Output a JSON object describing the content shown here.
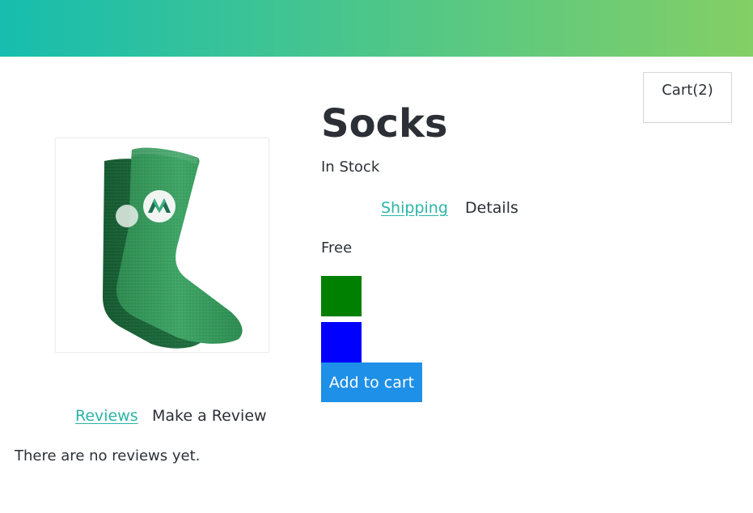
{
  "header": {
    "gradient_start": "#17bdae",
    "gradient_end": "#84cf66"
  },
  "cart": {
    "label": "Cart(2)"
  },
  "product": {
    "title": "Socks",
    "stock_status": "In Stock",
    "image": {
      "description": "green-sock-pair-with-logo",
      "icon": "sock-image"
    }
  },
  "info_tabs": {
    "shipping_label": "Shipping",
    "details_label": "Details",
    "active": "Details",
    "shipping_value": "Free"
  },
  "variants": [
    {
      "name": "green",
      "color": "#008000"
    },
    {
      "name": "blue",
      "color": "#0000ff"
    }
  ],
  "add_to_cart": {
    "label": "Add to cart",
    "color": "#1e90e8"
  },
  "review_tabs": {
    "reviews_label": "Reviews",
    "make_review_label": "Make a Review",
    "active": "Make a Review"
  },
  "reviews": {
    "empty_message": "There are no reviews yet."
  }
}
